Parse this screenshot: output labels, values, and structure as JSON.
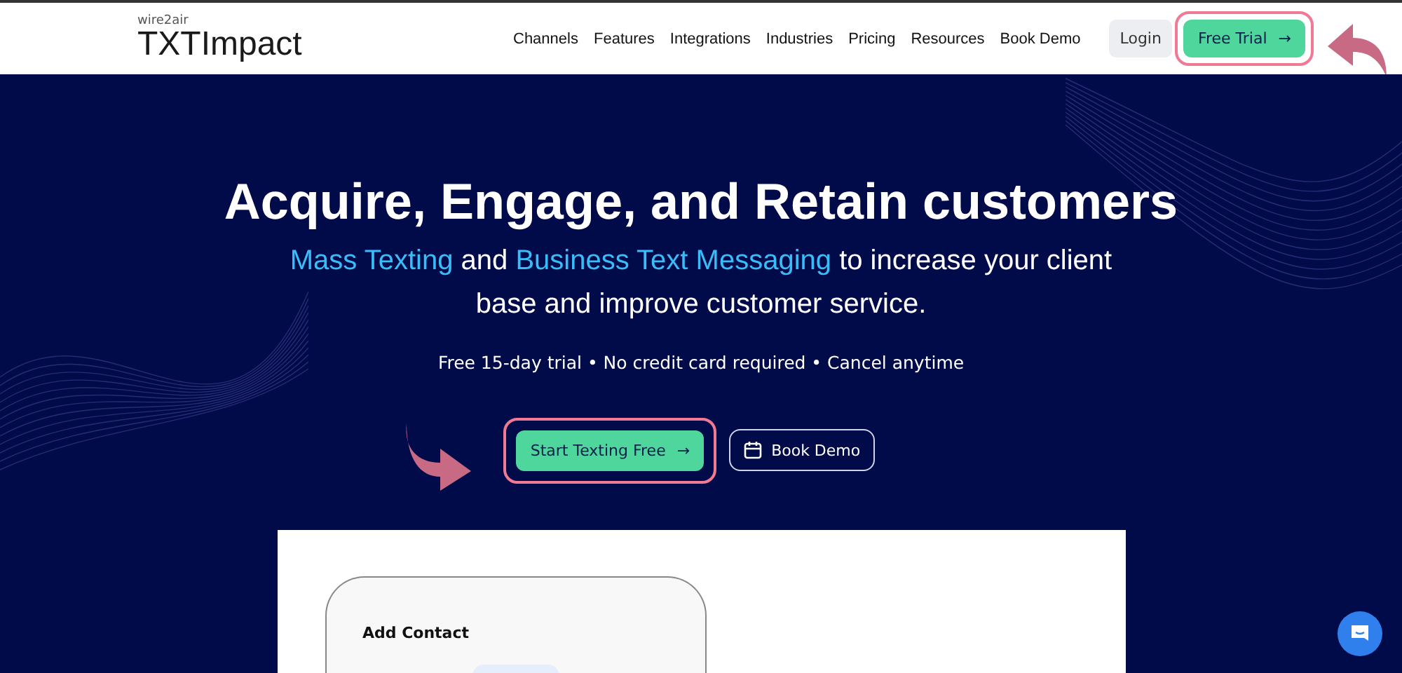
{
  "header": {
    "brand_small": "wire2air",
    "logo": "TXTImpact",
    "nav": [
      {
        "label": "Channels"
      },
      {
        "label": "Features"
      },
      {
        "label": "Integrations"
      },
      {
        "label": "Industries"
      },
      {
        "label": "Pricing"
      },
      {
        "label": "Resources"
      },
      {
        "label": "Book Demo"
      }
    ],
    "login": "Login",
    "free_trial": "Free Trial",
    "free_trial_arrow": "→"
  },
  "hero": {
    "headline": "Acquire, Engage, and Retain customers",
    "subtitle": [
      {
        "text": "Mass Texting",
        "highlight": true
      },
      {
        "text": " and ",
        "highlight": false
      },
      {
        "text": "Business Text Messaging",
        "highlight": true
      },
      {
        "text": " to increase your client base and improve customer service.",
        "highlight": false
      }
    ],
    "trial_note": "Free 15-day trial • No credit card required • Cancel anytime",
    "primary_button": "Start Texting Free",
    "primary_arrow": "→",
    "secondary_button": "Book Demo"
  },
  "preview": {
    "card_title": "Add Contact"
  }
}
